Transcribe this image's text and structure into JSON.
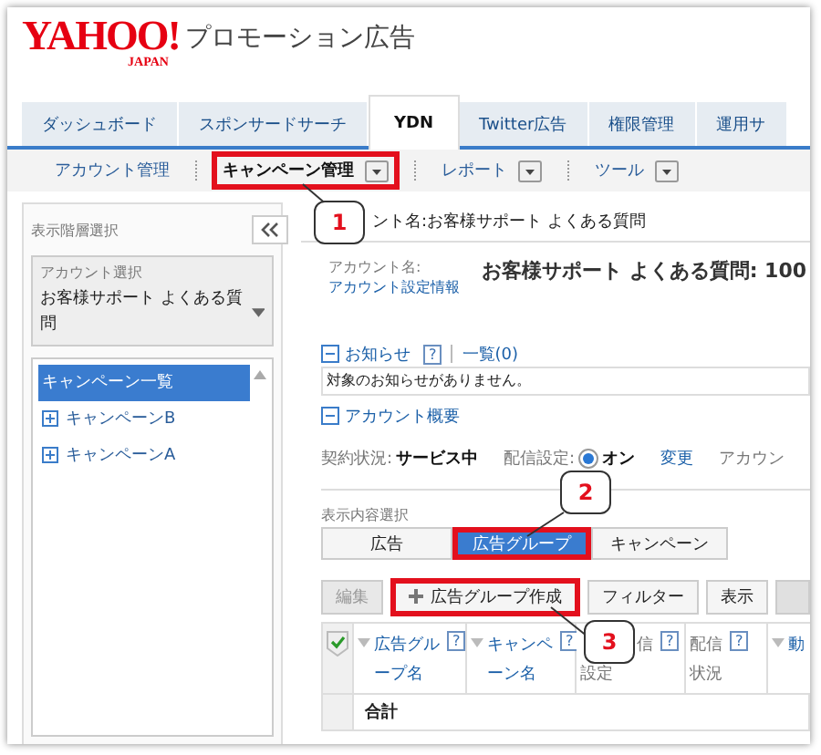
{
  "logo": {
    "brand": "YAHOO!",
    "sub": "JAPAN",
    "product": "プロモーション広告"
  },
  "tabs": [
    {
      "label": "ダッシュボード",
      "selected": false
    },
    {
      "label": "スポンサードサーチ",
      "selected": false
    },
    {
      "label": "YDN",
      "selected": true
    },
    {
      "label": "Twitter広告",
      "selected": false
    },
    {
      "label": "権限管理",
      "selected": false
    },
    {
      "label": "運用サ",
      "selected": false
    }
  ],
  "subnav": [
    {
      "label": "アカウント管理",
      "selected": false,
      "dropdown": false,
      "highlighted": false
    },
    {
      "label": "キャンペーン管理",
      "selected": true,
      "dropdown": true,
      "highlighted": true
    },
    {
      "label": "レポート",
      "selected": false,
      "dropdown": true,
      "highlighted": false
    },
    {
      "label": "ツール",
      "selected": false,
      "dropdown": true,
      "highlighted": false
    }
  ],
  "sidebar": {
    "title": "表示階層選択",
    "account_select": {
      "label": "アカウント選択",
      "value": "お客様サポート よくある質問"
    },
    "tree": [
      {
        "label": "キャンペーン一覧",
        "selected": true,
        "expandable": false
      },
      {
        "label": "キャンペーンB",
        "selected": false,
        "expandable": true
      },
      {
        "label": "キャンペーンA",
        "selected": false,
        "expandable": true
      }
    ]
  },
  "main": {
    "header": "ント名:お客様サポート よくある質問",
    "account_label": "アカウント名:",
    "account_link": "アカウント設定情報",
    "account_title": "お客様サポート よくある質問: 100",
    "notices": {
      "title": "お知らせ",
      "help": "?",
      "list_link": "一覧(0)",
      "message": "対象のお知らせがありません。"
    },
    "overview": {
      "title": "アカウント概要",
      "contract_label": "契約状況:",
      "contract_value": "サービス中",
      "delivery_label": "配信設定:",
      "delivery_on": true,
      "delivery_value": "オン",
      "change_link": "変更",
      "cut_label": "アカウン"
    },
    "view_select": {
      "label": "表示内容選択",
      "options": [
        {
          "label": "広告",
          "selected": false,
          "highlighted": false
        },
        {
          "label": "広告グループ",
          "selected": true,
          "highlighted": true
        },
        {
          "label": "キャンペーン",
          "selected": false,
          "highlighted": false
        }
      ]
    },
    "toolbar": [
      {
        "label": "編集",
        "kind": "plain",
        "disabled": true,
        "highlighted": false
      },
      {
        "label": "広告グループ作成",
        "kind": "add",
        "disabled": false,
        "highlighted": true
      },
      {
        "label": "フィルター",
        "kind": "plain",
        "disabled": false,
        "highlighted": false
      },
      {
        "label": "表示",
        "kind": "plain",
        "disabled": false,
        "highlighted": false
      }
    ],
    "table": {
      "columns": [
        {
          "lines": [
            "広告グル",
            "ープ名"
          ],
          "sortable": true,
          "help": "?"
        },
        {
          "lines": [
            "キャンペ",
            "ーン名"
          ],
          "sortable": true,
          "help": "?"
        },
        {
          "lines": [
            "信",
            "設定"
          ],
          "sortable": false,
          "help": "?"
        },
        {
          "lines": [
            "配信",
            "状況"
          ],
          "sortable": false,
          "help": "?"
        },
        {
          "lines": [
            "動"
          ],
          "sortable": true
        }
      ],
      "total_label": "合計"
    }
  },
  "callouts": [
    {
      "number": "1"
    },
    {
      "number": "2"
    },
    {
      "number": "3"
    }
  ]
}
